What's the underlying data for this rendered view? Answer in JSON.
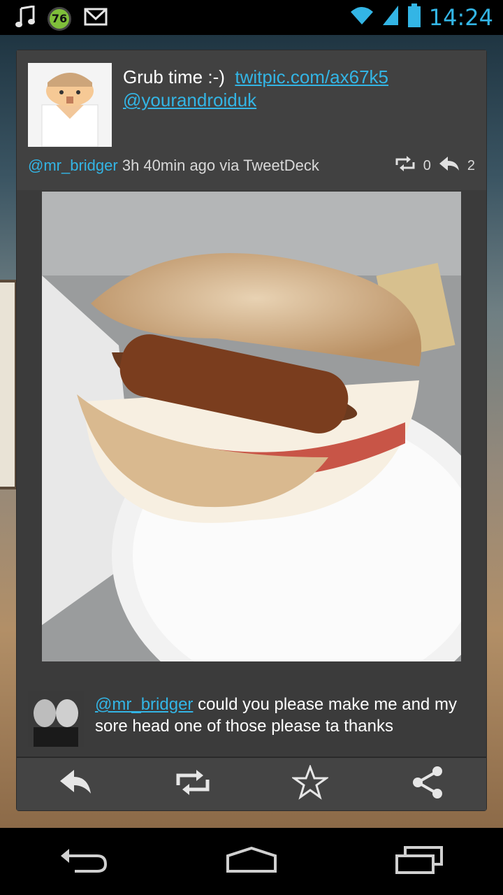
{
  "status_bar": {
    "time": "14:24",
    "notification_badge": "76",
    "icons": [
      "music-note-icon",
      "notification-badge",
      "gmail-icon",
      "wifi-icon",
      "signal-icon",
      "battery-icon"
    ]
  },
  "tweet": {
    "text": "Grub time :-)",
    "link": "twitpic.com/ax67k5",
    "mention": "@yourandroiduk",
    "author": "@mr_bridger",
    "meta": "3h 40min ago via TweetDeck",
    "retweet_count": "0",
    "reply_count": "2"
  },
  "reply": {
    "mention": "@mr_bridger",
    "text": " could you please make me and my sore head one of those please ta thanks"
  },
  "actions": [
    "reply-icon",
    "retweet-icon",
    "favorite-icon",
    "share-icon"
  ],
  "navigation": [
    "back-icon",
    "home-icon",
    "recents-icon"
  ],
  "colors": {
    "accent": "#33b5e5",
    "card_bg": "#3b3b3b",
    "text": "#ffffff"
  }
}
